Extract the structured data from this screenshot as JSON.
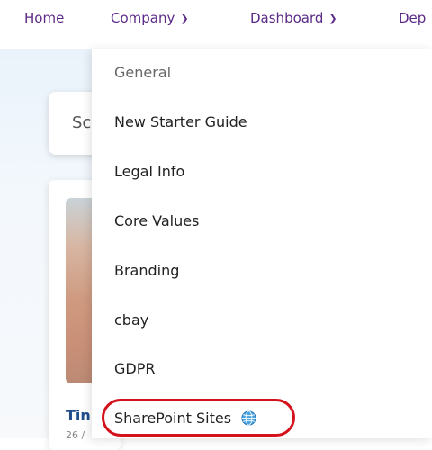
{
  "nav": {
    "items": [
      {
        "label": "Home",
        "has_dropdown": false
      },
      {
        "label": "Company",
        "has_dropdown": true
      },
      {
        "label": "Dashboard",
        "has_dropdown": true
      },
      {
        "label": "Dep",
        "has_dropdown": false
      }
    ],
    "chevron_icon": "chevron-down-icon",
    "color": "#5b2a86"
  },
  "background": {
    "search_partial": "Sc",
    "news_title_partial": "Tin",
    "news_date_partial": "26 /"
  },
  "dropdown": {
    "items": [
      {
        "label": "General",
        "type": "header"
      },
      {
        "label": "New Starter Guide"
      },
      {
        "label": "Legal Info"
      },
      {
        "label": "Core Values"
      },
      {
        "label": "Branding"
      },
      {
        "label": "cbay"
      },
      {
        "label": "GDPR"
      },
      {
        "label": "SharePoint Sites",
        "icon": "globe-icon",
        "highlighted": true
      }
    ],
    "highlight_color": "#d4121c"
  }
}
